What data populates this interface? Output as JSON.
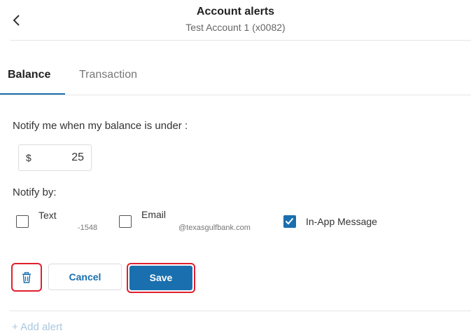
{
  "header": {
    "title": "Account alerts",
    "subtitle": "Test Account 1 (x0082)",
    "back_icon": "chevron-left-icon"
  },
  "tabs": [
    {
      "label": "Balance",
      "active": true
    },
    {
      "label": "Transaction",
      "active": false
    }
  ],
  "balance_alert": {
    "prompt": "Notify me when my balance is under :",
    "currency_symbol": "$",
    "amount": "25"
  },
  "notify_by": {
    "label": "Notify by:",
    "options": [
      {
        "label": "Text",
        "detail": "-1548",
        "checked": false
      },
      {
        "label": "Email",
        "detail": "@texasgulfbank.com",
        "checked": false
      },
      {
        "label": "In-App Message",
        "detail": "",
        "checked": true
      }
    ]
  },
  "actions": {
    "delete_icon": "trash-icon",
    "cancel_label": "Cancel",
    "save_label": "Save"
  },
  "add_alert_label": "+ Add alert",
  "colors": {
    "primary": "#1a6fae",
    "highlight": "#e0202e",
    "add_alert": "#a9c7df"
  }
}
